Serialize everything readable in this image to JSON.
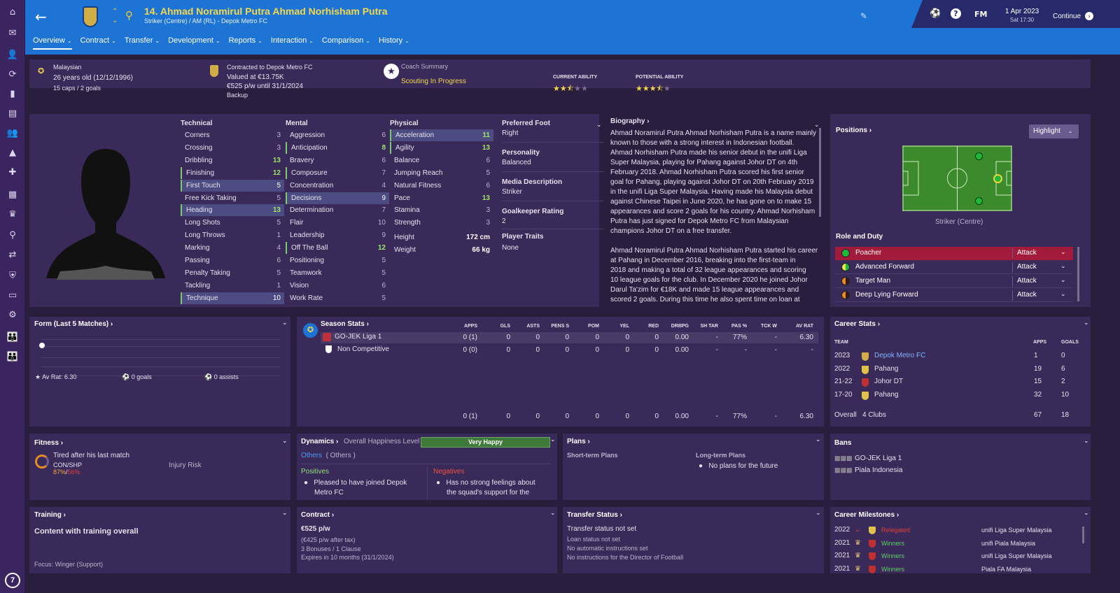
{
  "header": {
    "name": "14. Ahmad Noramirul Putra Ahmad Norhisham Putra",
    "subtitle": "Striker (Centre) / AM (RL) - Depok Metro FC",
    "tabs": [
      {
        "label": "Overview"
      },
      {
        "label": "Contract"
      },
      {
        "label": "Transfer"
      },
      {
        "label": "Development"
      },
      {
        "label": "Reports"
      },
      {
        "label": "Interaction"
      },
      {
        "label": "Comparison"
      },
      {
        "label": "History"
      }
    ],
    "date": "1 Apr 2023",
    "time": "Sat 17:30",
    "continue": "Continue",
    "fm": "FM",
    "help": "?"
  },
  "sidebar": {
    "badge": "7"
  },
  "info": {
    "nationality": "Malaysian",
    "age": "26 years old (12/12/1996)",
    "caps": "15 caps / 2 goals",
    "contracted": "Contracted to Depok Metro FC",
    "valued": "Valued at €13.75K",
    "wage": "€525 p/w until 31/1/2024",
    "status": "Backup",
    "coach_label": "Coach Summary",
    "coach_value": "Scouting In Progress",
    "ca_label": "CURRENT ABILITY",
    "pa_label": "POTENTIAL ABILITY",
    "ca_stars": 2.5,
    "pa_stars": 3.5
  },
  "attributes": {
    "technical_title": "Technical",
    "mental_title": "Mental",
    "physical_title": "Physical",
    "technical": [
      {
        "n": "Corners",
        "v": "3"
      },
      {
        "n": "Crossing",
        "v": "3"
      },
      {
        "n": "Dribbling",
        "v": "13"
      },
      {
        "n": "Finishing",
        "v": "12"
      },
      {
        "n": "First Touch",
        "v": "5"
      },
      {
        "n": "Free Kick Taking",
        "v": "5"
      },
      {
        "n": "Heading",
        "v": "13"
      },
      {
        "n": "Long Shots",
        "v": "5"
      },
      {
        "n": "Long Throws",
        "v": "1"
      },
      {
        "n": "Marking",
        "v": "4"
      },
      {
        "n": "Passing",
        "v": "6"
      },
      {
        "n": "Penalty Taking",
        "v": "5"
      },
      {
        "n": "Tackling",
        "v": "1"
      },
      {
        "n": "Technique",
        "v": "10"
      }
    ],
    "mental": [
      {
        "n": "Aggression",
        "v": "6"
      },
      {
        "n": "Anticipation",
        "v": "8"
      },
      {
        "n": "Bravery",
        "v": "6"
      },
      {
        "n": "Composure",
        "v": "7"
      },
      {
        "n": "Concentration",
        "v": "4"
      },
      {
        "n": "Decisions",
        "v": "9"
      },
      {
        "n": "Determination",
        "v": "7"
      },
      {
        "n": "Flair",
        "v": "10"
      },
      {
        "n": "Leadership",
        "v": "9"
      },
      {
        "n": "Off The Ball",
        "v": "12"
      },
      {
        "n": "Positioning",
        "v": "5"
      },
      {
        "n": "Teamwork",
        "v": "5"
      },
      {
        "n": "Vision",
        "v": "6"
      },
      {
        "n": "Work Rate",
        "v": "5"
      }
    ],
    "physical": [
      {
        "n": "Acceleration",
        "v": "11"
      },
      {
        "n": "Agility",
        "v": "13"
      },
      {
        "n": "Balance",
        "v": "6"
      },
      {
        "n": "Jumping Reach",
        "v": "5"
      },
      {
        "n": "Natural Fitness",
        "v": "6"
      },
      {
        "n": "Pace",
        "v": "13"
      },
      {
        "n": "Stamina",
        "v": "3"
      },
      {
        "n": "Strength",
        "v": "3"
      }
    ],
    "height_label": "Height",
    "height": "172 cm",
    "weight_label": "Weight",
    "weight": "66 kg"
  },
  "details": {
    "foot_label": "Preferred Foot",
    "foot": "Right",
    "personality_label": "Personality",
    "personality": "Balanced",
    "media_label": "Media Description",
    "media": "Striker",
    "gk_label": "Goalkeeper Rating",
    "gk": "2",
    "traits_label": "Player Traits",
    "traits": "None"
  },
  "biography": {
    "title": "Biography",
    "lines": [
      "Ahmad Noramirul Putra Ahmad Norhisham Putra is a name mainly",
      "known to those with a strong interest in Indonesian football.",
      "Ahmad Norhisham Putra made his senior debut in the unifi Liga",
      "Super Malaysia, playing for Pahang against Johor DT on 4th",
      "February 2018. Ahmad Norhisham Putra scored his first senior",
      "goal for Pahang, playing against Johor DT on 20th February 2019",
      "in the unifi Liga Super Malaysia. Having made his Malaysia debut",
      "against Chinese Taipei in June 2020, he has gone on to make 15",
      "appearances and score 2 goals for his country. Ahmad Norhisham",
      "Putra has just signed for Depok Metro FC from Malaysian",
      "champions Johor DT on a free transfer.",
      "",
      "Ahmad Noramirul Putra Ahmad Norhisham Putra started his career",
      "at Pahang in December 2016, breaking into the first-team in",
      "2018 and making a total of 32 league appearances and scoring",
      "10 league goals for the club. In December 2020 he joined Johor",
      "Darul Ta'zim for €18K and made 15 league appearances and",
      "scored 2 goals. During this time he also spent time on loan at"
    ]
  },
  "positions": {
    "title": "Positions",
    "highlight": "Highlight",
    "position": "Striker (Centre)",
    "role_title": "Role and Duty",
    "roles": [
      {
        "name": "Poacher",
        "duty": "Attack"
      },
      {
        "name": "Advanced Forward",
        "duty": "Attack"
      },
      {
        "name": "Target Man",
        "duty": "Attack"
      },
      {
        "name": "Deep Lying Forward",
        "duty": "Attack"
      }
    ]
  },
  "form": {
    "title": "Form (Last 5 Matches)",
    "avrat": "Av Rat: 6.30",
    "goals": "0 goals",
    "assists": "0 assists"
  },
  "season": {
    "title": "Season Stats",
    "headers": [
      "APPS",
      "GLS",
      "ASTS",
      "PENS S",
      "POM",
      "YEL",
      "RED",
      "DRBPG",
      "SH TAR",
      "PAS %",
      "TCK W",
      "AV RAT"
    ],
    "rows": [
      {
        "comp": "GO-JEK Liga 1",
        "vals": [
          "0 (1)",
          "0",
          "0",
          "0",
          "0",
          "0",
          "0",
          "0.00",
          "-",
          "77%",
          "-",
          "6.30"
        ]
      },
      {
        "comp": "Non Competitive",
        "vals": [
          "0 (0)",
          "0",
          "0",
          "0",
          "0",
          "0",
          "0",
          "0.00",
          "-",
          "-",
          "-",
          "-"
        ]
      }
    ],
    "total": [
      "0 (1)",
      "0",
      "0",
      "0",
      "0",
      "0",
      "0",
      "0.00",
      "-",
      "77%",
      "-",
      "6.30"
    ]
  },
  "career": {
    "title": "Career Stats",
    "team_h": "TEAM",
    "apps_h": "APPS",
    "goals_h": "GOALS",
    "rows": [
      {
        "year": "2023",
        "team": "Depok Metro FC",
        "apps": "1",
        "goals": "0"
      },
      {
        "year": "2022",
        "team": "Pahang",
        "apps": "19",
        "goals": "6"
      },
      {
        "year": "21-22",
        "team": "Johor DT",
        "apps": "15",
        "goals": "2"
      },
      {
        "year": "17-20",
        "team": "Pahang",
        "apps": "32",
        "goals": "10"
      }
    ],
    "overall": "Overall",
    "clubs": "4 Clubs",
    "tot_apps": "67",
    "tot_goals": "18"
  },
  "fitness": {
    "title": "Fitness",
    "status": "Tired after his last match",
    "con_label": "CON/SHP",
    "con": "87%",
    "shp": "56%",
    "slash": "/",
    "injury": "Injury Risk"
  },
  "dynamics": {
    "title": "Dynamics",
    "happiness_label": "Overall Happiness Level",
    "happiness": "Very Happy",
    "others": "Others",
    "others2": "( Others )",
    "positives": "Positives",
    "negatives": "Negatives",
    "pos1": "Pleased to have joined Depok",
    "pos2": "Metro FC",
    "neg1": "Has no strong feelings about",
    "neg2": "the squad's support for the"
  },
  "plans": {
    "title": "Plans",
    "short": "Short-term Plans",
    "long": "Long-term Plans",
    "long_item": "No plans for the future"
  },
  "bans": {
    "title": "Bans",
    "items": [
      "GO-JEK Liga 1",
      "Piala Indonesia"
    ]
  },
  "training": {
    "title": "Training",
    "status": "Content with training overall",
    "focus": "Focus: Winger (Support)"
  },
  "contract": {
    "title": "Contract",
    "wage": "€525 p/w",
    "aftertax": "(€425 p/w after tax)",
    "bonuses": "3 Bonuses / 1 Clause",
    "expires": "Expires in 10 months (31/1/2024)"
  },
  "transfer": {
    "title": "Transfer Status",
    "l1": "Transfer status not set",
    "l2": "Loan status not set",
    "l3": "No automatic instructions set",
    "l4": "No instructions for the Director of Football"
  },
  "milestones": {
    "title": "Career Milestones",
    "rows": [
      {
        "year": "2022",
        "result": "Relegated",
        "comp": "unifi Liga Super Malaysia"
      },
      {
        "year": "2021",
        "result": "Winners",
        "comp": "unifi Piala Malaysia"
      },
      {
        "year": "2021",
        "result": "Winners",
        "comp": "unifi Liga Super Malaysia"
      },
      {
        "year": "2021",
        "result": "Winners",
        "comp": "Piala FA Malaysia"
      }
    ]
  },
  "colors": {
    "header": "#1e74d4",
    "accent": "#f4d84b",
    "green": "#9ee468",
    "red": "#e0403a"
  }
}
